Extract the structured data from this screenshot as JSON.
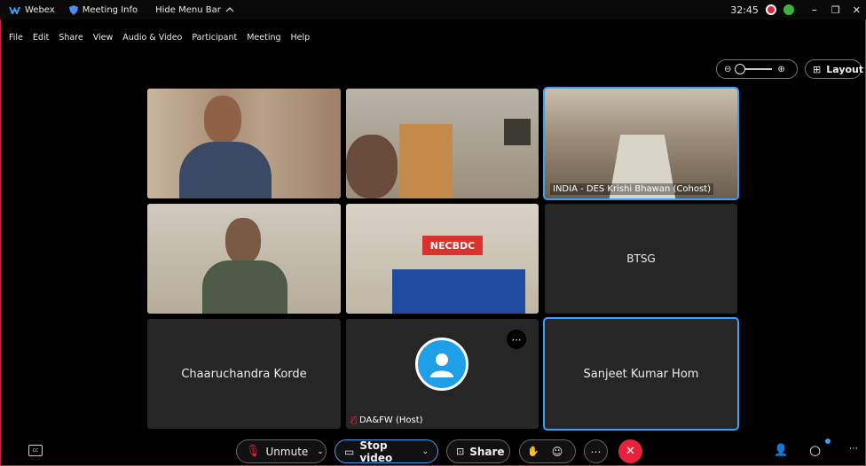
{
  "titlebar": {
    "app": "Webex",
    "meeting_info": "Meeting Info",
    "hide_menu": "Hide Menu Bar",
    "timer": "32:45"
  },
  "menu": [
    "File",
    "Edit",
    "Share",
    "View",
    "Audio & Video",
    "Participant",
    "Meeting",
    "Help"
  ],
  "controls": {
    "layout_label": "Layout"
  },
  "tiles": {
    "t3_caption": "INDIA - DES Krishi Bhawan (Cohost)",
    "t5_banner": "NECBDC",
    "t6_name": "BTSG",
    "t7_name": "Chaaruchandra Korde",
    "t8_caption": "DA&FW (Host)",
    "t9_name": "Sanjeet Kumar Hom"
  },
  "toolbar": {
    "unmute": "Unmute",
    "stop_video": "Stop video",
    "share": "Share"
  },
  "colors": {
    "accent": "#3aa0ff",
    "end_call": "#e5243b",
    "border": "#c8244a"
  }
}
